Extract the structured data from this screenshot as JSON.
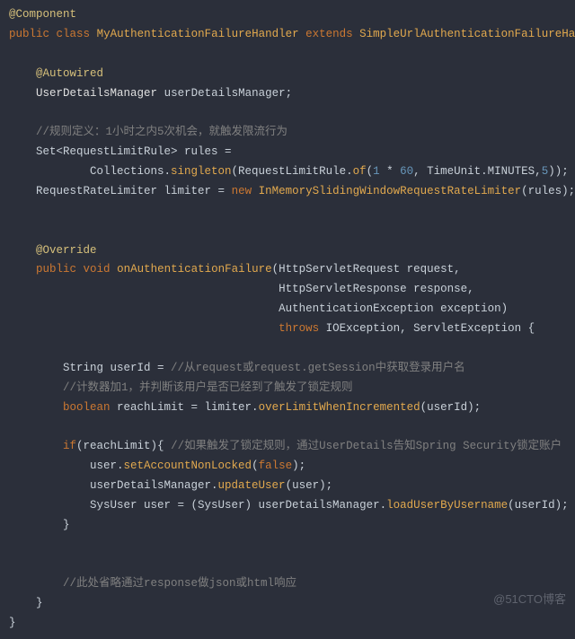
{
  "watermark": "@51CTO博客",
  "code": {
    "l1_ann": "@Component",
    "l2_kw1": "public",
    "l2_kw2": "class",
    "l2_cls": "MyAuthenticationFailureHandler",
    "l2_kw3": "extends",
    "l2_ext": "SimpleUrlAuthenticationFailureHandler",
    "l2_brace": " {",
    "l4_ann": "@Autowired",
    "l5_type": "UserDetailsManager",
    "l5_id": "userDetailsManager;",
    "l7_com": "//规则定义：1小时之内5次机会，就触发限流行为",
    "l8_a": "Set<RequestLimitRule> rules =",
    "l9_a": "Collections.",
    "l9_fn": "singleton",
    "l9_b": "(RequestLimitRule.",
    "l9_fn2": "of",
    "l9_c": "(",
    "l9_n1": "1",
    "l9_d": " * ",
    "l9_n2": "60",
    "l9_e": ", TimeUnit.MINUTES,",
    "l9_n3": "5",
    "l9_f": "));",
    "l10_a": "RequestRateLimiter limiter = ",
    "l10_kw": "new",
    "l10_b": " ",
    "l10_cls": "InMemorySlidingWindowRequestRateLimiter",
    "l10_c": "(rules);",
    "l13_ann": "@Override",
    "l14_kw1": "public",
    "l14_kw2": "void",
    "l14_fn": "onAuthenticationFailure",
    "l14_a": "(HttpServletRequest request,",
    "l15_a": "HttpServletResponse response,",
    "l16_a": "AuthenticationException exception)",
    "l17_kw": "throws",
    "l17_a": " IOException, ServletException {",
    "l19_a": "String userId = ",
    "l19_com": "//从request或request.getSession中获取登录用户名",
    "l20_com": "//计数器加1，并判断该用户是否已经到了触发了锁定规则",
    "l21_kw": "boolean",
    "l21_a": " reachLimit = limiter.",
    "l21_fn": "overLimitWhenIncremented",
    "l21_b": "(userId);",
    "l23_kw": "if",
    "l23_a": "(reachLimit){ ",
    "l23_com": "//如果触发了锁定规则，通过UserDetails告知Spring Security锁定账户",
    "l24_a": "user.",
    "l24_fn": "setAccountNonLocked",
    "l24_b": "(",
    "l24_bool": "false",
    "l24_c": ");",
    "l25_a": "userDetailsManager.",
    "l25_fn": "updateUser",
    "l25_b": "(user);",
    "l26_a": "SysUser user = (SysUser) userDetailsManager.",
    "l26_fn": "loadUserByUsername",
    "l26_b": "(userId);",
    "l27_brace": "}",
    "l30_com": "//此处省略通过response做json或html响应",
    "l31_brace": "}",
    "l32_brace": "}"
  }
}
